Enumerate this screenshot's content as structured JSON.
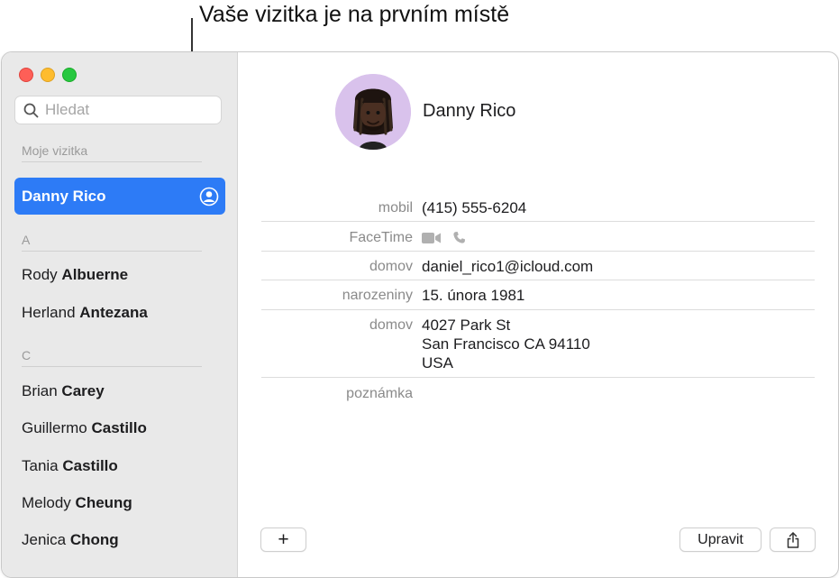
{
  "callout": {
    "text": "Vaše vizitka je na prvním místě"
  },
  "sidebar": {
    "search_placeholder": "Hledat",
    "my_card_header": "Moje vizitka",
    "selected_contact": "Danny Rico",
    "groups": [
      {
        "letter": "A",
        "contacts": [
          {
            "first": "Rody",
            "last": "Albuerne"
          },
          {
            "first": "Herland",
            "last": "Antezana"
          }
        ]
      },
      {
        "letter": "C",
        "contacts": [
          {
            "first": "Brian",
            "last": "Carey"
          },
          {
            "first": "Guillermo",
            "last": "Castillo"
          },
          {
            "first": "Tania",
            "last": "Castillo"
          },
          {
            "first": "Melody",
            "last": "Cheung"
          },
          {
            "first": "Jenica",
            "last": "Chong"
          }
        ]
      }
    ]
  },
  "detail": {
    "name": "Danny Rico",
    "fields": {
      "mobile_label": "mobil",
      "mobile_value": "(415) 555-6204",
      "facetime_label": "FaceTime",
      "email_label": "domov",
      "email_value": "daniel_rico1@icloud.com",
      "birthday_label": "narozeniny",
      "birthday_value": "15. února 1981",
      "address_label": "domov",
      "address_line1": "4027 Park St",
      "address_line2": "San Francisco CA 94110",
      "address_line3": "USA",
      "note_label": "poznámka"
    },
    "buttons": {
      "add": "+",
      "edit": "Upravit"
    }
  },
  "colors": {
    "accent": "#2d7bf6",
    "sidebar_bg": "#e9e9e9"
  }
}
